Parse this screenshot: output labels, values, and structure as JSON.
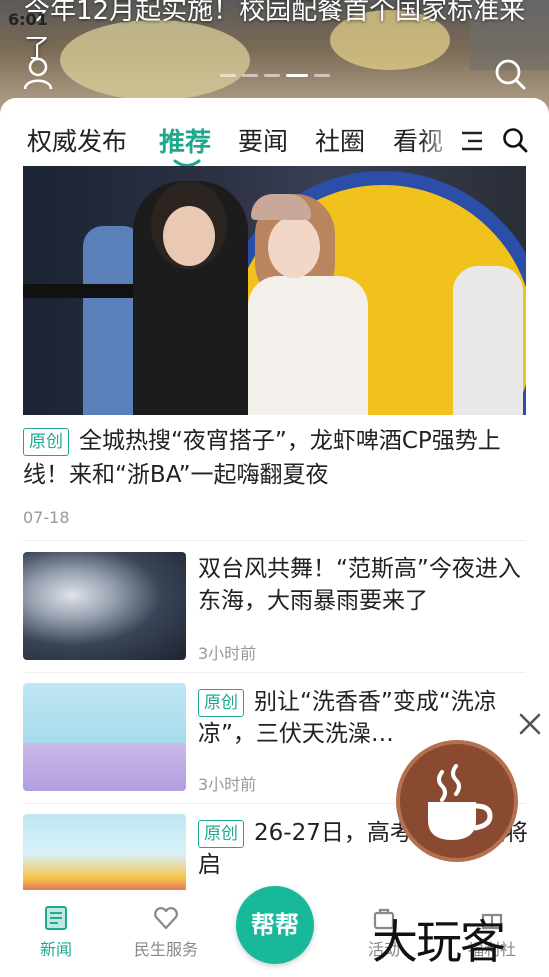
{
  "status_bar": {
    "time": "6:01"
  },
  "banner": {
    "title": "今年12月起实施！校园配餐首个国家标准来了",
    "dot_count": 5,
    "active_dot_index": 3
  },
  "tabs": [
    {
      "label": "权威发布",
      "active": false
    },
    {
      "label": "推荐",
      "active": true
    },
    {
      "label": "要闻",
      "active": false
    },
    {
      "label": "社圈",
      "active": false
    },
    {
      "label": "看视",
      "active": false
    }
  ],
  "feed": {
    "featured": {
      "badge": "原创",
      "title": "全城热搜“夜宵搭子”，龙虾啤酒CP强势上线！来和“浙BA”一起嗨翻夏夜",
      "time": "07-18"
    },
    "items": [
      {
        "badge": "",
        "title": "双台风共舞！“范斯高”今夜进入东海，大雨暴雨要来了",
        "time": "3小时前"
      },
      {
        "badge": "原创",
        "title": "别让“洗香香”变成“洗凉凉”，三伏天洗澡…",
        "time": "3小时前"
      },
      {
        "badge": "原创",
        "title": "26-27日，高考志愿填报将启",
        "time": ""
      }
    ]
  },
  "bottom_nav": {
    "items": [
      {
        "label": "新闻",
        "active": true
      },
      {
        "label": "民生服务",
        "active": false
      },
      {
        "label": "活动",
        "active": false
      },
      {
        "label": "福利社",
        "active": false
      }
    ],
    "center_button": "帮帮"
  },
  "watermark": "大玩客",
  "colors": {
    "accent": "#1fa88e",
    "help_button": "#18b99a"
  }
}
